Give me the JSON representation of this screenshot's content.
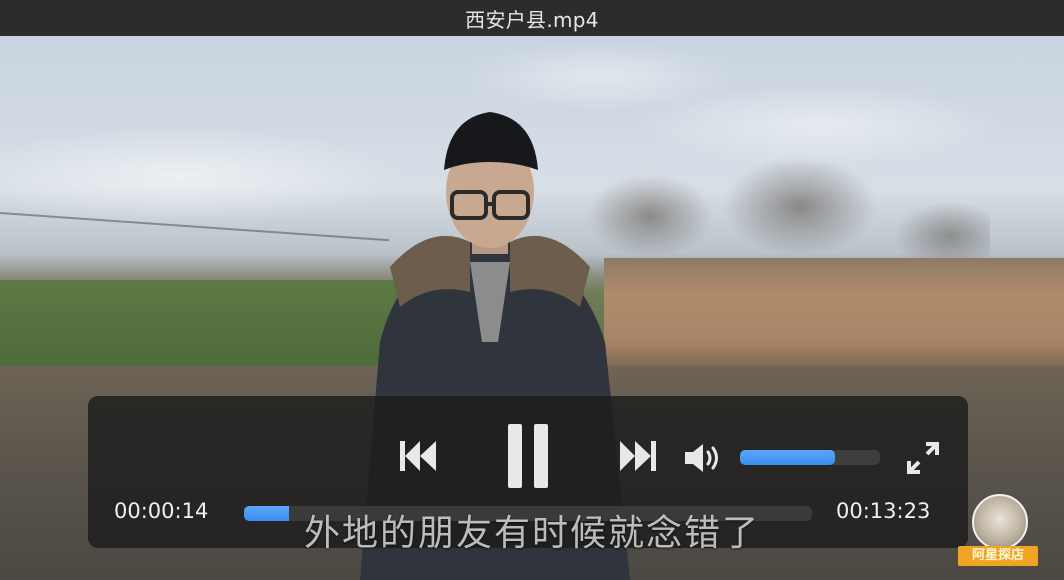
{
  "window": {
    "title": "西安户县.mp4"
  },
  "player": {
    "current_time": "00:00:14",
    "total_time": "00:13:23",
    "progress_fraction": 0.08,
    "volume_fraction": 0.68,
    "state": "playing",
    "accent_color": "#3a8cf0"
  },
  "controls": {
    "rewind_icon": "rewind-icon",
    "pause_icon": "pause-icon",
    "fast_forward_icon": "fast-forward-icon",
    "volume_icon": "speaker-icon",
    "fullscreen_icon": "fullscreen-icon"
  },
  "subtitle": "外地的朋友有时候就念错了",
  "watermark": {
    "label": "阿星探店"
  }
}
